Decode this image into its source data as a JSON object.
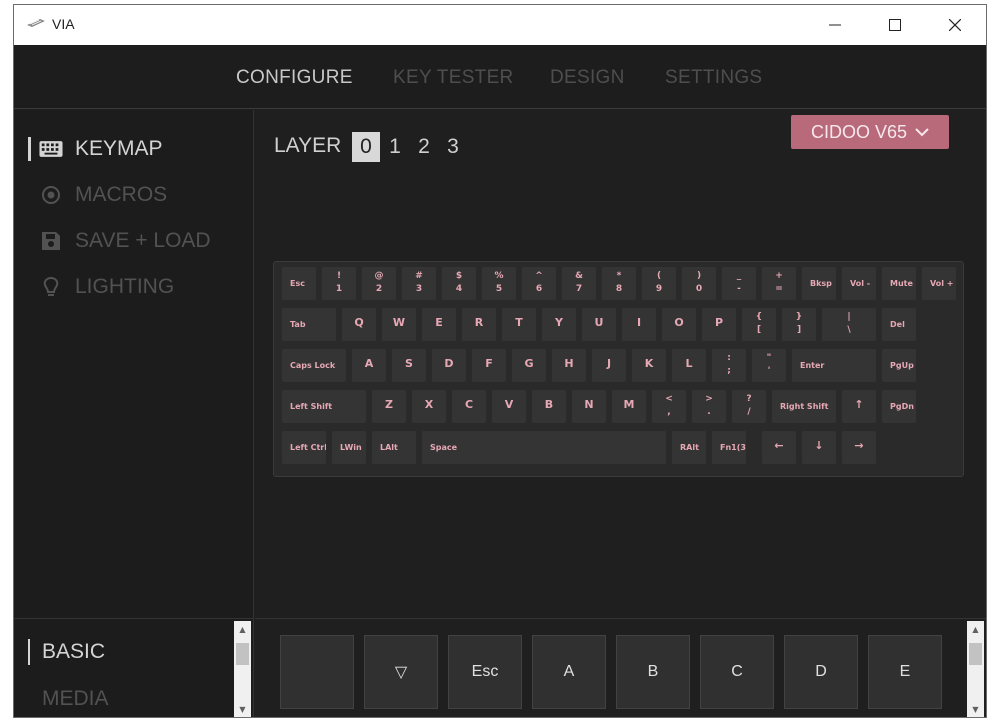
{
  "window": {
    "title": "VIA"
  },
  "topnav": {
    "tabs": [
      "CONFIGURE",
      "KEY TESTER",
      "DESIGN",
      "SETTINGS"
    ]
  },
  "sidebar": {
    "items": [
      "KEYMAP",
      "MACROS",
      "SAVE + LOAD",
      "LIGHTING"
    ]
  },
  "main": {
    "layer_label": "LAYER",
    "layers": [
      "0",
      "1",
      "2",
      "3"
    ],
    "device": "CIDOO V65"
  },
  "keyboard": {
    "rows": [
      [
        {
          "t": "Esc"
        },
        {
          "t": "!",
          "b": "1"
        },
        {
          "t": "@",
          "b": "2"
        },
        {
          "t": "#",
          "b": "3"
        },
        {
          "t": "$",
          "b": "4"
        },
        {
          "t": "%",
          "b": "5"
        },
        {
          "t": "^",
          "b": "6"
        },
        {
          "t": "&",
          "b": "7"
        },
        {
          "t": "*",
          "b": "8"
        },
        {
          "t": "(",
          "b": "9"
        },
        {
          "t": ")",
          "b": "0"
        },
        {
          "t": "_",
          "b": "-"
        },
        {
          "t": "+",
          "b": "="
        },
        {
          "t": "Bksp"
        },
        {
          "t": "Vol -"
        },
        {
          "t": "Mute"
        },
        {
          "t": "Vol +"
        }
      ],
      [
        {
          "t": "Tab"
        },
        {
          "t": "Q"
        },
        {
          "t": "W"
        },
        {
          "t": "E"
        },
        {
          "t": "R"
        },
        {
          "t": "T"
        },
        {
          "t": "Y"
        },
        {
          "t": "U"
        },
        {
          "t": "I"
        },
        {
          "t": "O"
        },
        {
          "t": "P"
        },
        {
          "t": "{",
          "b": "["
        },
        {
          "t": "}",
          "b": "]"
        },
        {
          "t": "|",
          "b": "\\"
        },
        {
          "t": "Del"
        }
      ],
      [
        {
          "t": "Caps Lock"
        },
        {
          "t": "A"
        },
        {
          "t": "S"
        },
        {
          "t": "D"
        },
        {
          "t": "F"
        },
        {
          "t": "G"
        },
        {
          "t": "H"
        },
        {
          "t": "J"
        },
        {
          "t": "K"
        },
        {
          "t": "L"
        },
        {
          "t": ":",
          "b": ";"
        },
        {
          "t": "\"",
          "b": "'"
        },
        {
          "t": "Enter"
        },
        {
          "t": "PgUp"
        }
      ],
      [
        {
          "t": "Left Shift"
        },
        {
          "t": "Z"
        },
        {
          "t": "X"
        },
        {
          "t": "C"
        },
        {
          "t": "V"
        },
        {
          "t": "B"
        },
        {
          "t": "N"
        },
        {
          "t": "M"
        },
        {
          "t": "<",
          "b": ","
        },
        {
          "t": ">",
          "b": "."
        },
        {
          "t": "?",
          "b": "/"
        },
        {
          "t": "Right Shift"
        },
        {
          "t": "↑"
        },
        {
          "t": "PgDn"
        }
      ],
      [
        {
          "t": "Left Ctrl"
        },
        {
          "t": "LWin"
        },
        {
          "t": "LAlt"
        },
        {
          "t": "Space"
        },
        {
          "t": "RAlt"
        },
        {
          "t": "Fn1(3)"
        },
        {
          "t": "←"
        },
        {
          "t": "↓"
        },
        {
          "t": "→"
        }
      ]
    ]
  },
  "bottom": {
    "categories": [
      "BASIC",
      "MEDIA"
    ],
    "picker_keys": [
      "",
      "▽",
      "Esc",
      "A",
      "B",
      "C",
      "D",
      "E"
    ]
  },
  "colors": {
    "accent": "#b86a7b",
    "legend": "#e6a8b4",
    "background": "#1f1f1f"
  }
}
